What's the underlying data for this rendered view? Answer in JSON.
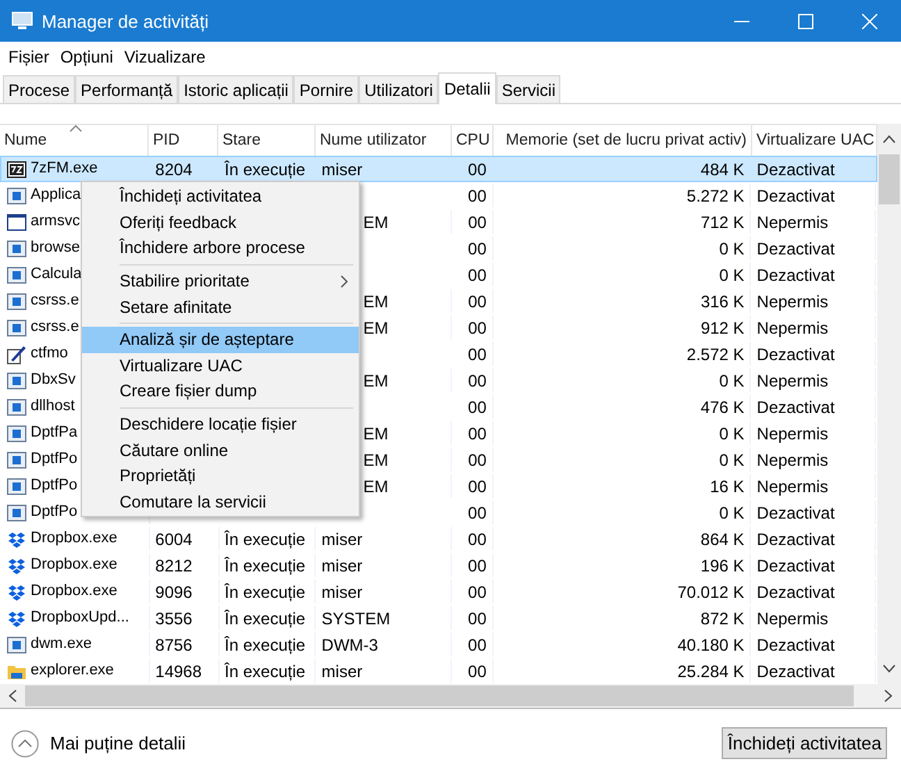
{
  "window": {
    "title": "Manager de activități"
  },
  "menu_bar": [
    "Fișier",
    "Opțiuni",
    "Vizualizare"
  ],
  "tabs": [
    {
      "label": "Procese",
      "selected": false
    },
    {
      "label": "Performanță",
      "selected": false
    },
    {
      "label": "Istoric aplicații",
      "selected": false
    },
    {
      "label": "Pornire",
      "selected": false
    },
    {
      "label": "Utilizatori",
      "selected": false
    },
    {
      "label": "Detalii",
      "selected": true
    },
    {
      "label": "Servicii",
      "selected": false
    }
  ],
  "table": {
    "columns": [
      "Nume",
      "PID",
      "Stare",
      "Nume utilizator",
      "CPU",
      "Memorie (set de lucru privat activ)",
      "Virtualizare UAC"
    ],
    "rows": [
      {
        "kind": "archive",
        "name": "7zFM.exe",
        "pid": "8204",
        "status": "În execuție",
        "user": "miser",
        "cpu": "00",
        "memory": "484 K",
        "uac": "Dezactivat",
        "selected": true
      },
      {
        "kind": "app",
        "name": "Applica",
        "cpu": "00",
        "memory": "5.272 K",
        "uac": "Dezactivat",
        "selected": false
      },
      {
        "kind": "window",
        "name": "armsvc",
        "user": "EM",
        "cpu": "00",
        "memory": "712 K",
        "uac": "Nepermis",
        "selected": false
      },
      {
        "kind": "app",
        "name": "browse",
        "cpu": "00",
        "memory": "0 K",
        "uac": "Dezactivat",
        "selected": false
      },
      {
        "kind": "app",
        "name": "Calcula",
        "cpu": "00",
        "memory": "0 K",
        "uac": "Dezactivat",
        "selected": false
      },
      {
        "kind": "app",
        "name": "csrss.e",
        "user": "EM",
        "cpu": "00",
        "memory": "316 K",
        "uac": "Nepermis",
        "selected": false
      },
      {
        "kind": "app",
        "name": "csrss.e",
        "user": "EM",
        "cpu": "00",
        "memory": "912 K",
        "uac": "Nepermis",
        "selected": false
      },
      {
        "kind": "pen",
        "name": "ctfmo",
        "cpu": "00",
        "memory": "2.572 K",
        "uac": "Dezactivat",
        "selected": false
      },
      {
        "kind": "app",
        "name": "DbxSv",
        "user": "EM",
        "cpu": "00",
        "memory": "0 K",
        "uac": "Nepermis",
        "selected": false
      },
      {
        "kind": "app",
        "name": "dllhost",
        "cpu": "00",
        "memory": "476 K",
        "uac": "Dezactivat",
        "selected": false
      },
      {
        "kind": "app",
        "name": "DptfPa",
        "user": "EM",
        "cpu": "00",
        "memory": "0 K",
        "uac": "Nepermis",
        "selected": false
      },
      {
        "kind": "app",
        "name": "DptfPo",
        "user": "EM",
        "cpu": "00",
        "memory": "0 K",
        "uac": "Nepermis",
        "selected": false
      },
      {
        "kind": "app",
        "name": "DptfPo",
        "user": "EM",
        "cpu": "00",
        "memory": "16 K",
        "uac": "Nepermis",
        "selected": false
      },
      {
        "kind": "app",
        "name": "DptfPo",
        "cpu": "00",
        "memory": "0 K",
        "uac": "Dezactivat",
        "selected": false
      },
      {
        "kind": "dropbox",
        "name": "Dropbox.exe",
        "pid": "6004",
        "status": "În execuție",
        "user": "miser",
        "cpu": "00",
        "memory": "864 K",
        "uac": "Dezactivat",
        "selected": false
      },
      {
        "kind": "dropbox",
        "name": "Dropbox.exe",
        "pid": "8212",
        "status": "În execuție",
        "user": "miser",
        "cpu": "00",
        "memory": "196 K",
        "uac": "Dezactivat",
        "selected": false
      },
      {
        "kind": "dropbox",
        "name": "Dropbox.exe",
        "pid": "9096",
        "status": "În execuție",
        "user": "miser",
        "cpu": "00",
        "memory": "70.012 K",
        "uac": "Dezactivat",
        "selected": false
      },
      {
        "kind": "dropbox",
        "name": "DropboxUpd...",
        "pid": "3556",
        "status": "În execuție",
        "user": "SYSTEM",
        "cpu": "00",
        "memory": "872 K",
        "uac": "Nepermis",
        "selected": false
      },
      {
        "kind": "app",
        "name": "dwm.exe",
        "pid": "8756",
        "status": "În execuție",
        "user": "DWM-3",
        "cpu": "00",
        "memory": "40.180 K",
        "uac": "Dezactivat",
        "selected": false
      },
      {
        "kind": "folder",
        "name": "explorer.exe",
        "pid": "14968",
        "status": "În execuție",
        "user": "miser",
        "cpu": "00",
        "memory": "25.284 K",
        "uac": "Dezactivat",
        "selected": false
      }
    ]
  },
  "context_menu": {
    "items": [
      {
        "kind": "item",
        "label": "Închideți activitatea",
        "selected": false,
        "submenu": false
      },
      {
        "kind": "item",
        "label": "Oferiți feedback",
        "selected": false,
        "submenu": false
      },
      {
        "kind": "item",
        "label": "Închidere arbore procese",
        "selected": false,
        "submenu": false
      },
      {
        "kind": "separator"
      },
      {
        "kind": "item",
        "label": "Stabilire prioritate",
        "selected": false,
        "submenu": true
      },
      {
        "kind": "item",
        "label": "Setare afinitate",
        "selected": false,
        "submenu": false
      },
      {
        "kind": "separator"
      },
      {
        "kind": "item",
        "label": "Analiză șir de așteptare",
        "selected": true,
        "submenu": false
      },
      {
        "kind": "item",
        "label": "Virtualizare UAC",
        "selected": false,
        "submenu": false
      },
      {
        "kind": "item",
        "label": "Creare fișier dump",
        "selected": false,
        "submenu": false
      },
      {
        "kind": "separator"
      },
      {
        "kind": "item",
        "label": "Deschidere locație fișier",
        "selected": false,
        "submenu": false
      },
      {
        "kind": "item",
        "label": "Căutare online",
        "selected": false,
        "submenu": false
      },
      {
        "kind": "item",
        "label": "Proprietăți",
        "selected": false,
        "submenu": false
      },
      {
        "kind": "item",
        "label": "Comutare la servicii",
        "selected": false,
        "submenu": false
      }
    ]
  },
  "footer": {
    "details_toggle": "Mai puține detalii",
    "end_task_button": "Închideți activitatea"
  }
}
